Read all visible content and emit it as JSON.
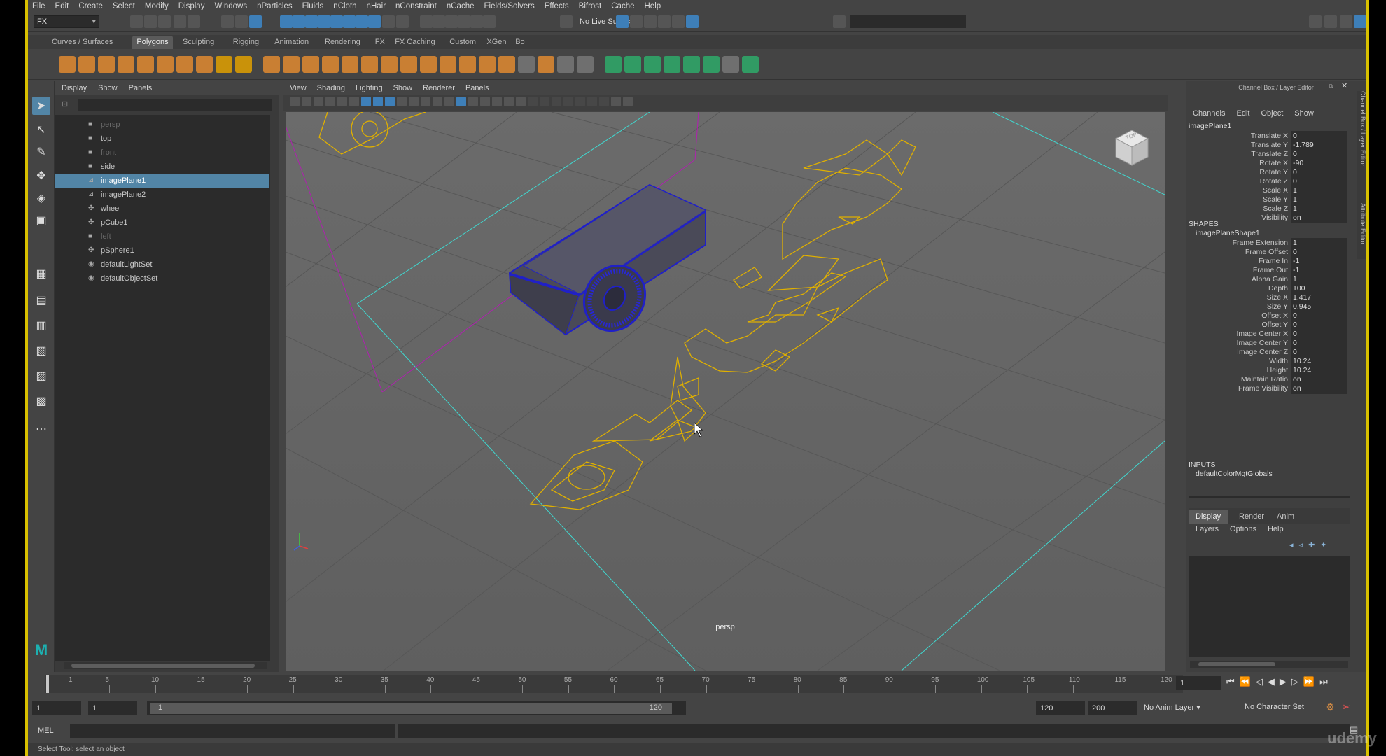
{
  "menubar": [
    "File",
    "Edit",
    "Create",
    "Select",
    "Modify",
    "Display",
    "Windows",
    "nParticles",
    "Fluids",
    "nCloth",
    "nHair",
    "nConstraint",
    "nCache",
    "Fields/Solvers",
    "Effects",
    "Bifrost",
    "Cache",
    "Help"
  ],
  "statusline": {
    "mode": "FX",
    "live_surface": "No Live Surface"
  },
  "shelf_tabs": [
    "Curves / Surfaces",
    "Polygons",
    "Sculpting",
    "Rigging",
    "Animation",
    "Rendering",
    "FX",
    "FX Caching",
    "Custom",
    "XGen",
    "Bo"
  ],
  "shelf_active": "Polygons",
  "outliner": {
    "menu": [
      "Display",
      "Show",
      "Panels"
    ],
    "items": [
      {
        "label": "persp",
        "icon": "camera-icon",
        "dim": true
      },
      {
        "label": "top",
        "icon": "camera-icon",
        "dim": false
      },
      {
        "label": "front",
        "icon": "camera-icon",
        "dim": true
      },
      {
        "label": "side",
        "icon": "camera-icon",
        "dim": false
      },
      {
        "label": "imagePlane1",
        "icon": "image-plane-icon",
        "dim": false,
        "selected": true
      },
      {
        "label": "imagePlane2",
        "icon": "image-plane-icon",
        "dim": false
      },
      {
        "label": "wheel",
        "icon": "mesh-icon",
        "dim": false
      },
      {
        "label": "pCube1",
        "icon": "mesh-icon",
        "dim": false
      },
      {
        "label": "left",
        "icon": "camera-icon",
        "dim": true
      },
      {
        "label": "pSphere1",
        "icon": "mesh-icon",
        "dim": false
      },
      {
        "label": "defaultLightSet",
        "icon": "set-icon",
        "dim": false
      },
      {
        "label": "defaultObjectSet",
        "icon": "set-icon",
        "dim": false
      }
    ]
  },
  "viewport": {
    "menu": [
      "View",
      "Shading",
      "Lighting",
      "Show",
      "Renderer",
      "Panels"
    ],
    "camera": "persp",
    "viewcube_top": "TOP"
  },
  "channelbox": {
    "title": "Channel Box / Layer Editor",
    "menu": [
      "Channels",
      "Edit",
      "Object",
      "Show"
    ],
    "node": "imagePlane1",
    "attrs": [
      {
        "name": "Translate X",
        "value": "0"
      },
      {
        "name": "Translate Y",
        "value": "-1.789"
      },
      {
        "name": "Translate Z",
        "value": "0"
      },
      {
        "name": "Rotate X",
        "value": "-90"
      },
      {
        "name": "Rotate Y",
        "value": "0"
      },
      {
        "name": "Rotate Z",
        "value": "0"
      },
      {
        "name": "Scale X",
        "value": "1"
      },
      {
        "name": "Scale Y",
        "value": "1"
      },
      {
        "name": "Scale Z",
        "value": "1"
      },
      {
        "name": "Visibility",
        "value": "on"
      }
    ],
    "shapes_header": "SHAPES",
    "shape_node": "imagePlaneShape1",
    "shape_attrs": [
      {
        "name": "Frame Extension",
        "value": "1"
      },
      {
        "name": "Frame Offset",
        "value": "0"
      },
      {
        "name": "Frame In",
        "value": "-1"
      },
      {
        "name": "Frame Out",
        "value": "-1"
      },
      {
        "name": "Alpha Gain",
        "value": "1"
      },
      {
        "name": "Depth",
        "value": "100"
      },
      {
        "name": "Size X",
        "value": "1.417"
      },
      {
        "name": "Size Y",
        "value": "0.945"
      },
      {
        "name": "Offset X",
        "value": "0"
      },
      {
        "name": "Offset Y",
        "value": "0"
      },
      {
        "name": "Image Center X",
        "value": "0"
      },
      {
        "name": "Image Center Y",
        "value": "0"
      },
      {
        "name": "Image Center Z",
        "value": "0"
      },
      {
        "name": "Width",
        "value": "10.24"
      },
      {
        "name": "Height",
        "value": "10.24"
      },
      {
        "name": "Maintain Ratio",
        "value": "on"
      },
      {
        "name": "Frame Visibility",
        "value": "on"
      }
    ],
    "inputs_header": "INPUTS",
    "input_node": "defaultColorMgtGlobals",
    "layer_tabs": [
      "Display",
      "Render",
      "Anim"
    ],
    "layer_menu": [
      "Layers",
      "Options",
      "Help"
    ]
  },
  "side_tabs": [
    "Channel Box / Layer Editor",
    "Attribute Editor"
  ],
  "timeslider": {
    "ticks": [
      "1",
      "5",
      "10",
      "15",
      "20",
      "25",
      "30",
      "35",
      "40",
      "45",
      "50",
      "55",
      "60",
      "65",
      "70",
      "75",
      "80",
      "85",
      "90",
      "95",
      "100",
      "105",
      "110",
      "115",
      "120"
    ],
    "current_frame": "1"
  },
  "range": {
    "start": "1",
    "playback_start": "1",
    "slider_start": "1",
    "slider_end": "120",
    "playback_end": "120",
    "end": "200",
    "anim_layer": "No Anim Layer",
    "character_set": "No Character Set"
  },
  "cmdline": {
    "label": "MEL"
  },
  "helpline": "Select Tool: select an object",
  "watermark": "udemy",
  "colors": {
    "accent_border": "#d8c000",
    "selection": "#5285a6",
    "wireframe_selected": "#1e1ec8",
    "image_plane_outline": "#e0b000"
  }
}
